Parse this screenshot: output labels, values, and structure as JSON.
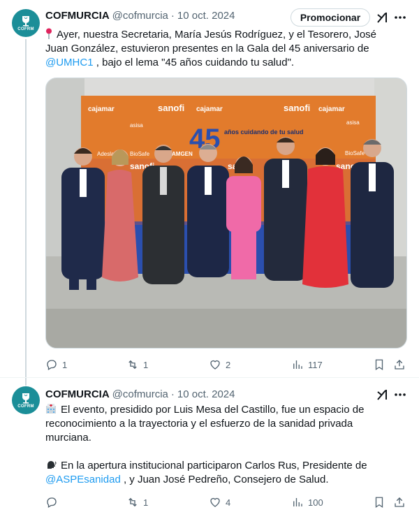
{
  "tweets": [
    {
      "author_name": "COFMURCIA",
      "handle": "@cofmurcia",
      "date": "10 oct. 2024",
      "avatar_text": "COFRM",
      "promote_label": "Promocionar",
      "text_part1": "Ayer, nuestra Secretaria, María Jesús Rodríguez, y el Tesorero, José Juan González, estuvieron presentes en la Gala del 45 aniversario de ",
      "mention": "@UMHC1",
      "text_part2": " , bajo el lema \"45 años cuidando tu salud\".",
      "media": {
        "backdrop_text_1": "cajamar",
        "backdrop_text_2": "sanofi",
        "backdrop_text_3": "45",
        "backdrop_text_4": "años cuidando de tu salud",
        "backdrop_text_5": "Adeslas",
        "backdrop_text_6": "BioSafe",
        "backdrop_text_7": "asisa",
        "backdrop_text_8": "AMGEN"
      },
      "replies": "1",
      "reposts": "1",
      "likes": "2",
      "views": "117"
    },
    {
      "author_name": "COFMURCIA",
      "handle": "@cofmurcia",
      "date": "10 oct. 2024",
      "avatar_text": "COFRM",
      "paragraph1": "El evento, presidido por Luis Mesa del Castillo, fue un espacio de reconocimiento a la trayectoria y el esfuerzo de la sanidad privada murciana.",
      "paragraph2_part1": "En la apertura institucional participaron Carlos Rus, Presidente de ",
      "mention": "@ASPEsanidad",
      "paragraph2_part2": " , y Juan José Pedreño, Consejero de Salud.",
      "replies": "",
      "reposts": "1",
      "likes": "4",
      "views": "100"
    }
  ],
  "icons": {
    "accent": "#1d9bf0",
    "muted": "#536471",
    "avatar_bg": "#1b8e98"
  }
}
